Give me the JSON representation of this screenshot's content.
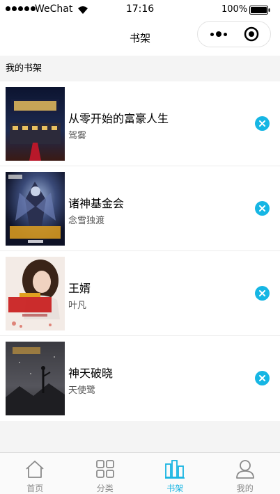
{
  "status_bar": {
    "carrier": "WeChat",
    "time": "17:16",
    "battery": "100%"
  },
  "nav": {
    "title": "书架"
  },
  "section": {
    "title": "我的书架"
  },
  "books": [
    {
      "title": "从零开始的富豪人生",
      "author": "驾雾"
    },
    {
      "title": "诸神基金会",
      "author": "念雪独渡"
    },
    {
      "title": "王婿",
      "author": "叶凡"
    },
    {
      "title": "神天破晓",
      "author": "天使鹭"
    }
  ],
  "tabs": [
    {
      "label": "首页",
      "icon": "home-icon"
    },
    {
      "label": "分类",
      "icon": "grid-icon"
    },
    {
      "label": "书架",
      "icon": "bookshelf-icon",
      "active": true
    },
    {
      "label": "我的",
      "icon": "user-icon"
    }
  ],
  "colors": {
    "accent": "#16b6e4",
    "inactive": "#8a8a8a"
  }
}
